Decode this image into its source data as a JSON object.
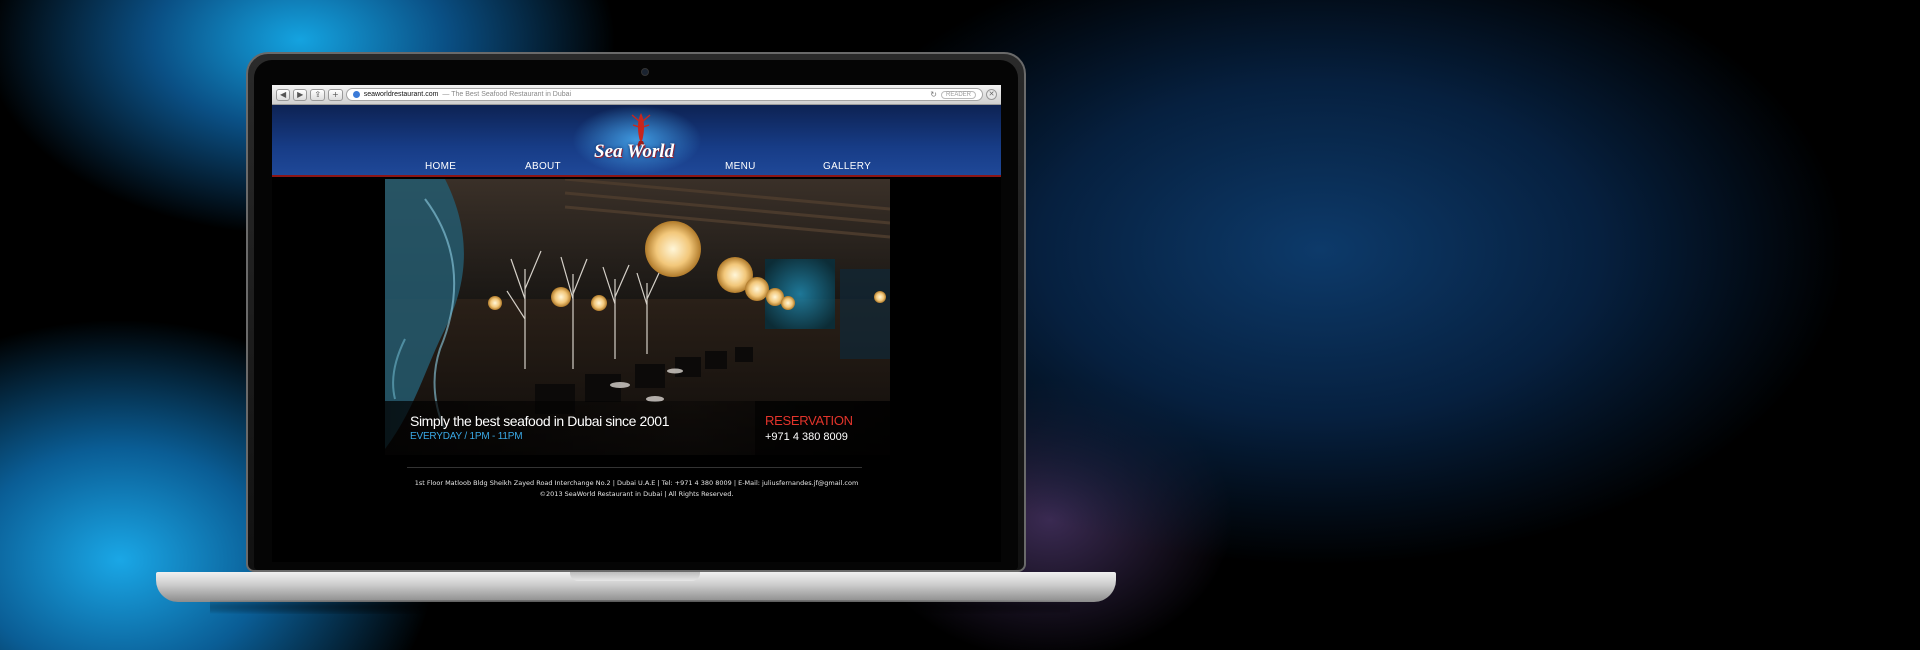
{
  "browser": {
    "url": "seaworldrestaurant.com",
    "page_title": "— The Best Seafood Restaurant in Dubai",
    "back_label": "◀",
    "forward_label": "▶",
    "share_label": "⇪",
    "add_label": "+",
    "reload_label": "↻",
    "reader_label": "READER",
    "stop_label": "✕"
  },
  "site": {
    "logo_text": "Sea World",
    "nav": [
      "HOME",
      "ABOUT",
      "MENU",
      "GALLERY"
    ],
    "hero": {
      "tagline": "Simply the best seafood in Dubai since 2001",
      "hours": "EVERYDAY / 1PM - 11PM",
      "reservation_label": "RESERVATION",
      "phone": "+971 4 380 8009"
    },
    "footer": {
      "address": "1st Floor Matloob Bldg Sheikh Zayed Road Interchange No.2 | Dubai U.A.E | Tel: +971 4 380 8009 | E-Mail: juliusfernandes.jf@gmail.com",
      "copyright": "©2013 SeaWorld Restaurant in Dubai | All Rights Reserved."
    }
  },
  "colors": {
    "header_blue": "#173c86",
    "accent_red": "#e2342b",
    "hours_blue": "#3aa9e6"
  }
}
